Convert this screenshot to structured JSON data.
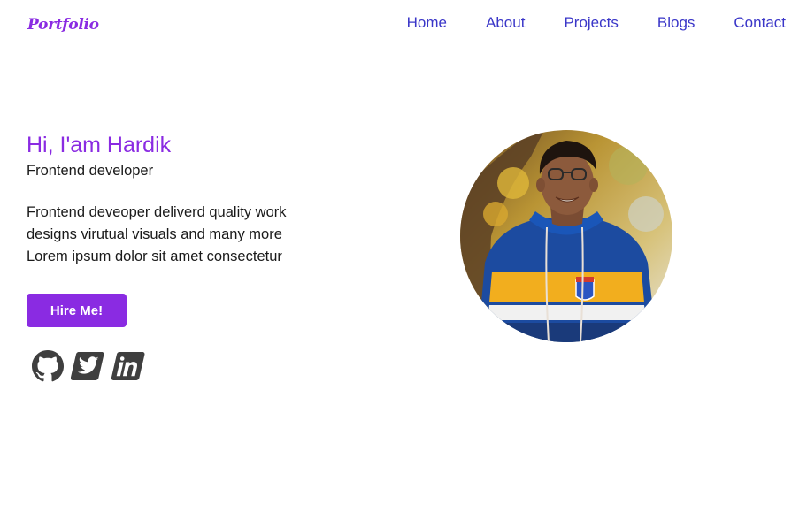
{
  "logo": {
    "text": "Portfolio"
  },
  "nav": {
    "links": [
      "Home",
      "About",
      "Projects",
      "Blogs",
      "Contact"
    ]
  },
  "hero": {
    "greeting": "Hi, I'am Hardik",
    "role": "Frontend developer",
    "description_lines": [
      "Frontend deveoper deliverd quality work",
      "designs virutual visuals and many more",
      "Lorem ipsum dolor sit amet consectetur"
    ],
    "cta_label": "Hire Me!"
  },
  "socials": {
    "icons": [
      "github-icon",
      "twitter-icon",
      "linkedin-icon"
    ]
  },
  "colors": {
    "accent": "#8a2be2",
    "nav_link": "#3a36c8",
    "icon": "#3f3f3f",
    "text": "#1a1a1a"
  }
}
